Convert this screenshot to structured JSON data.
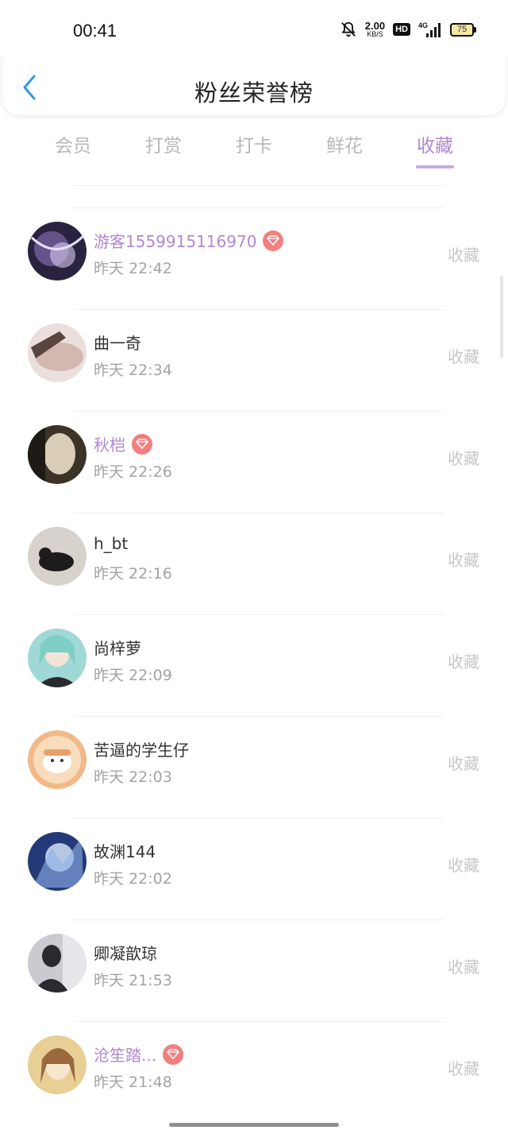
{
  "status_bar": {
    "time": "00:41",
    "net_speed_value": "2.00",
    "net_speed_unit": "KB/S",
    "hd_label": "HD",
    "network_label": "4G",
    "battery": "75"
  },
  "header": {
    "title": "粉丝荣誉榜",
    "back_icon": "chevron-left-icon"
  },
  "tabs": [
    {
      "label": "会员",
      "active": false
    },
    {
      "label": "打赏",
      "active": false
    },
    {
      "label": "打卡",
      "active": false
    },
    {
      "label": "鲜花",
      "active": false
    },
    {
      "label": "收藏",
      "active": true
    }
  ],
  "colors": {
    "accent": "#b088d2",
    "vip_badge": "#f0807f",
    "back_arrow": "#2e9be6"
  },
  "list": [
    {
      "name": "游客1559915116970",
      "time": "昨天 22:42",
      "action": "收藏",
      "vip": true
    },
    {
      "name": "曲一奇",
      "time": "昨天 22:34",
      "action": "收藏",
      "vip": false
    },
    {
      "name": "秋桤",
      "time": "昨天 22:26",
      "action": "收藏",
      "vip": true
    },
    {
      "name": "h_bt",
      "time": "昨天 22:16",
      "action": "收藏",
      "vip": false
    },
    {
      "name": "尚梓萝",
      "time": "昨天 22:09",
      "action": "收藏",
      "vip": false
    },
    {
      "name": "苦逼的学生仔",
      "time": "昨天 22:03",
      "action": "收藏",
      "vip": false
    },
    {
      "name": "故渊144",
      "time": "昨天 22:02",
      "action": "收藏",
      "vip": false
    },
    {
      "name": "卿凝歆琼",
      "time": "昨天 21:53",
      "action": "收藏",
      "vip": false
    },
    {
      "name": "沧笙踏...",
      "time": "昨天 21:48",
      "action": "收藏",
      "vip": true
    }
  ]
}
